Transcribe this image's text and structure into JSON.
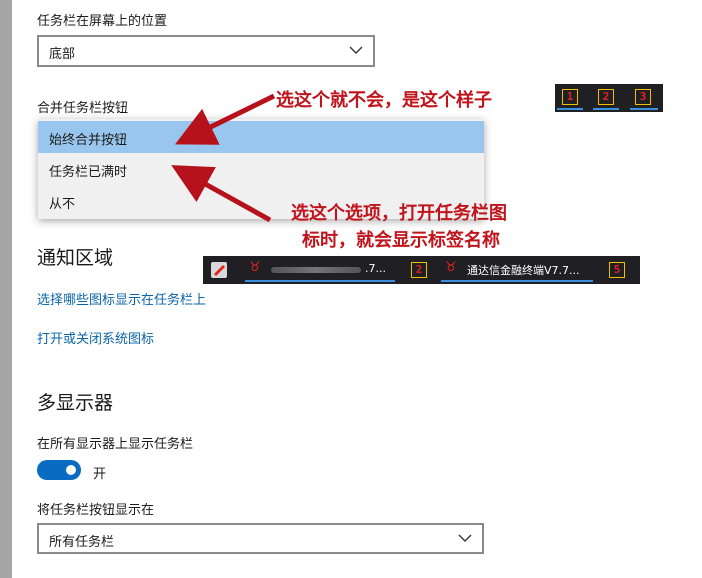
{
  "settings": {
    "taskbar_position": {
      "label": "任务栏在屏幕上的位置",
      "value": "底部"
    },
    "combine_buttons": {
      "label": "合并任务栏按钮",
      "options": [
        "始终合并按钮",
        "任务栏已满时",
        "从不"
      ],
      "selected_index": 0
    },
    "notification_area": {
      "title": "通知区域",
      "link_icons": "选择哪些图标显示在任务栏上",
      "link_system_icons": "打开或关闭系统图标"
    },
    "multiple_displays": {
      "title": "多显示器",
      "show_on_all_label": "在所有显示器上显示任务栏",
      "toggle_state": "开",
      "toggle_on": true,
      "show_buttons_label": "将任务栏按钮显示在",
      "show_buttons_value": "所有任务栏"
    }
  },
  "annotations": {
    "note_always_combine": "选这个就不会，是这个样子",
    "note_when_full_line1": "选这个选项，打开任务栏图",
    "note_when_full_line2": "标时，就会显示标签名称",
    "color": "#c0141c"
  },
  "taskbar_samples": {
    "combined_digits": [
      "1",
      "2",
      "3"
    ],
    "labeled": {
      "item1_text": ".7...",
      "digit1": "2",
      "item2_text": "通达信金融终端V7.7...",
      "digit2": "5"
    }
  },
  "colors": {
    "accent": "#0a6bc2",
    "link": "#0a64a8",
    "selection": "#99c6ee"
  }
}
